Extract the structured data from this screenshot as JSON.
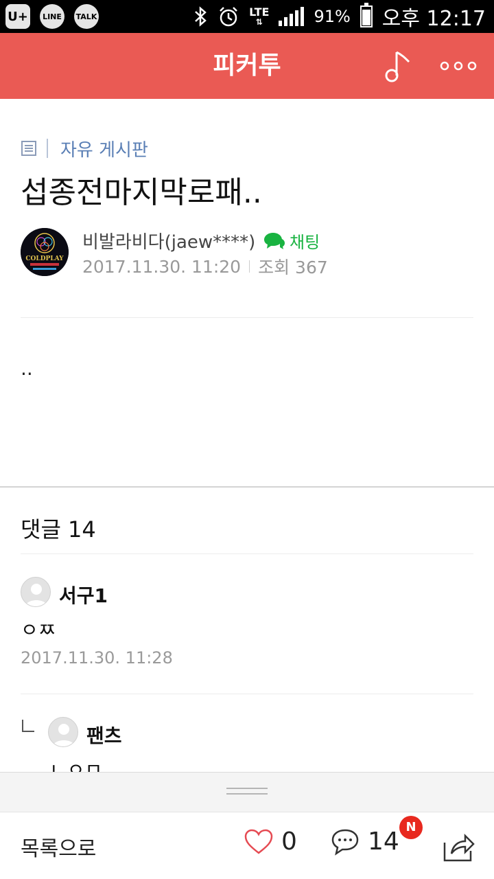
{
  "status_bar": {
    "apps": [
      "U+",
      "LINE",
      "TALK"
    ],
    "network": "LTE",
    "battery": "91%",
    "time": "오후 12:17"
  },
  "header": {
    "title": "피커투"
  },
  "post": {
    "board": "자유 게시판",
    "title": "섭종전마지막로패..",
    "author": "비발라비다(jaew****)",
    "chat_label": "채팅",
    "date": "2017.11.30. 11:20",
    "views_label": "조회 367",
    "body": "..",
    "avatar_text": "COLDPLAY"
  },
  "comments": {
    "header": "댓글 14",
    "items": [
      {
        "author": "서구1",
        "text": "ㅇㅉ",
        "date": "2017.11.30. 11:28",
        "is_reply": false
      },
      {
        "author": "팬츠",
        "text": "ㄴㅇㅁ",
        "is_reply": true
      }
    ]
  },
  "bottom_bar": {
    "back_label": "목록으로",
    "like_count": "0",
    "comment_count": "14",
    "new_badge": "N"
  },
  "colors": {
    "header_bg": "#ea5a54",
    "board_link": "#5a7fb5",
    "chat_green": "#19b341",
    "like_heart": "#e54a52",
    "badge_red": "#e8291f"
  },
  "icons": [
    "music-note-icon",
    "more-icon",
    "board-list-icon",
    "chat-bubble-icon",
    "heart-icon",
    "comment-icon",
    "share-icon",
    "bluetooth-icon",
    "alarm-icon",
    "signal-icon",
    "battery-icon"
  ]
}
